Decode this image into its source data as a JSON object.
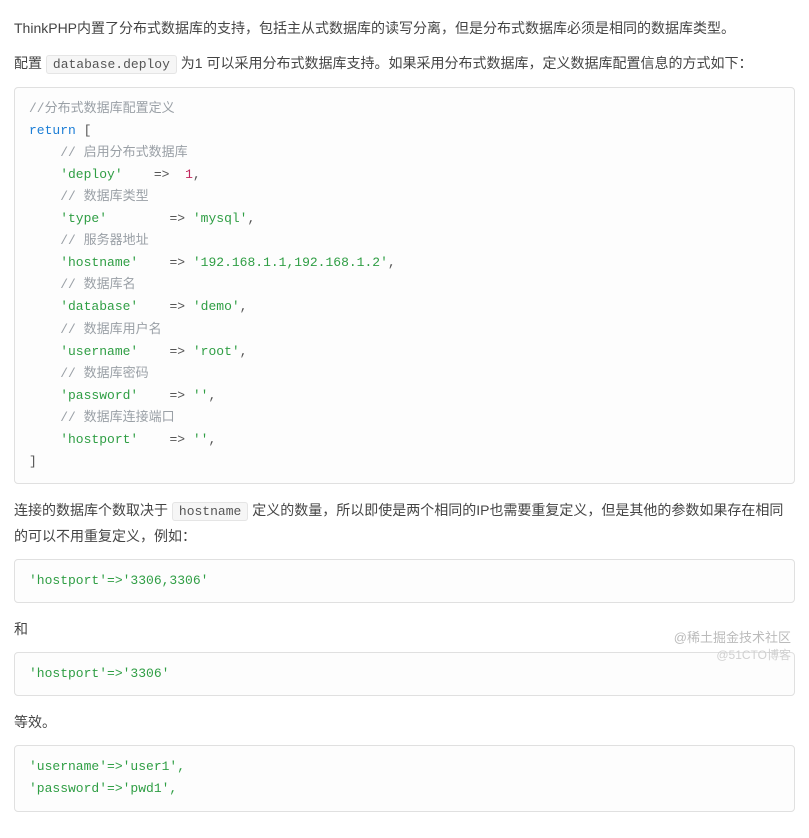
{
  "para1_a": "ThinkPHP内置了分布式数据库的支持，包括主从式数据库的读写分离，但是分布式数据库必须是相同的数据库类型。",
  "para2_a": "配置 ",
  "inline1": "database.deploy",
  "para2_b": " 为1 可以采用分布式数据库支持。如果采用分布式数据库，定义数据库配置信息的方式如下：",
  "code1": {
    "c_top": "//分布式数据库配置定义",
    "kw_return": "return",
    "lbracket": " [",
    "c_deploy": "    // 启用分布式数据库",
    "k_deploy": "    'deploy'",
    "arrow": "=>",
    "v_deploy": "1",
    "comma": ",",
    "c_type": "    // 数据库类型",
    "k_type": "    'type'",
    "v_type": "'mysql'",
    "c_host": "    // 服务器地址",
    "k_host": "    'hostname'",
    "v_host": "'192.168.1.1,192.168.1.2'",
    "c_db": "    // 数据库名",
    "k_db": "    'database'",
    "v_db": "'demo'",
    "c_user": "    // 数据库用户名",
    "k_user": "    'username'",
    "v_user": "'root'",
    "c_pwd": "    // 数据库密码",
    "k_pwd": "    'password'",
    "v_pwd": "''",
    "c_port": "    // 数据库连接端口",
    "k_port": "    'hostport'",
    "v_port": "''",
    "rbracket": "]"
  },
  "para3_a": "连接的数据库个数取决于 ",
  "inline2": "hostname",
  "para3_b": " 定义的数量，所以即使是两个相同的IP也需要重复定义，但是其他的参数如果存在相同的可以不用重复定义，例如：",
  "code2": {
    "line": "'hostport'=>'3306,3306'"
  },
  "para4": "和",
  "code3": {
    "line": "'hostport'=>'3306'"
  },
  "para5": "等效。",
  "code4": {
    "l1": "'username'=>'user1',",
    "l2": "'password'=>'pwd1',"
  },
  "watermark1": "@稀土掘金技术社区",
  "watermark2": "@51CTO博客"
}
